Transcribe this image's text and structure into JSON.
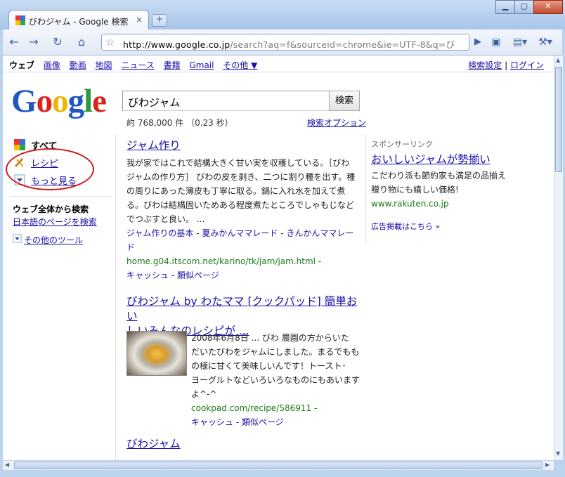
{
  "browser": {
    "tab_title": "びわジャム - Google 検索",
    "tab_close": "×",
    "new_tab": "+",
    "url_host": "http://www.google.co.jp",
    "url_path": "/search?aq=f&sourceid=chrome&ie=UTF-8&q=び",
    "win_minimize": "▁",
    "win_maximize": "▢",
    "win_close": "✕"
  },
  "gnav": {
    "items": [
      "ウェブ",
      "画像",
      "動画",
      "地図",
      "ニュース",
      "書籍",
      "Gmail",
      "その他 ▼"
    ],
    "settings": "検索設定",
    "separator": "|",
    "login": "ログイン"
  },
  "search": {
    "query": "びわジャム",
    "button": "検索",
    "stats": "約 768,000 件 （0.23 秒）",
    "options": "検索オプション"
  },
  "left": {
    "all": "すべて",
    "recipe": "レシピ",
    "more": "もっと見る",
    "web_heading": "ウェブ全体から検索",
    "japanese_pages": "日本語のページを検索",
    "other_tools": "その他のツール"
  },
  "results": [
    {
      "title": "ジャム作り",
      "snippet": [
        "我が家ではこれで結構大きく甘い実を収穫している。［びわ",
        "ジャムの作り方］ びわの皮を剥き、二つに割り種を出す。種",
        "の周りにあった薄皮も丁寧に取る。鍋に入れ水を加えて煮",
        "る。びわは結構固いためある程度煮たところでしゃもじなど",
        "でつぶすと良い。 ..."
      ],
      "sublinks": [
        "ジャム作りの基本 - 夏みかんママレード - きんかんママレー",
        "ド"
      ],
      "cite": "home.g04.itscom.net/karino/tk/jam/jam.html -",
      "cache": "キャッシュ - 類似ページ"
    },
    {
      "title": [
        "びわジャム by わたママ [クックパッド] 簡単おい",
        "しいみんなのレシピが ..."
      ],
      "snippet": [
        "2008年6月8日 ... びわ 農園の方からいた",
        "だいたびわをジャムにしました。まるでもも",
        "の様に甘くて美味しいんです！トースト･",
        "ヨーグルトなどいろいろなものにもあいます",
        "よ^-^"
      ],
      "cite": "cookpad.com/recipe/586911 -",
      "cache": "キャッシュ - 類似ページ"
    },
    {
      "title": "びわジャム"
    }
  ],
  "ads": {
    "label": "スポンサーリンク",
    "title": "おいしいジャムが勢揃い",
    "lines": [
      "こだわり派も節約家も満足の品揃え",
      "贈り物にも嬉しい価格!"
    ],
    "cite": "www.rakuten.co.jp",
    "more": "広告掲載はこちら »"
  },
  "colors": {
    "link": "#1a0dab",
    "url_green": "#1a7a1a",
    "annotation_circle": "#d21b1b",
    "chrome_frame": "#bcd3ee"
  }
}
